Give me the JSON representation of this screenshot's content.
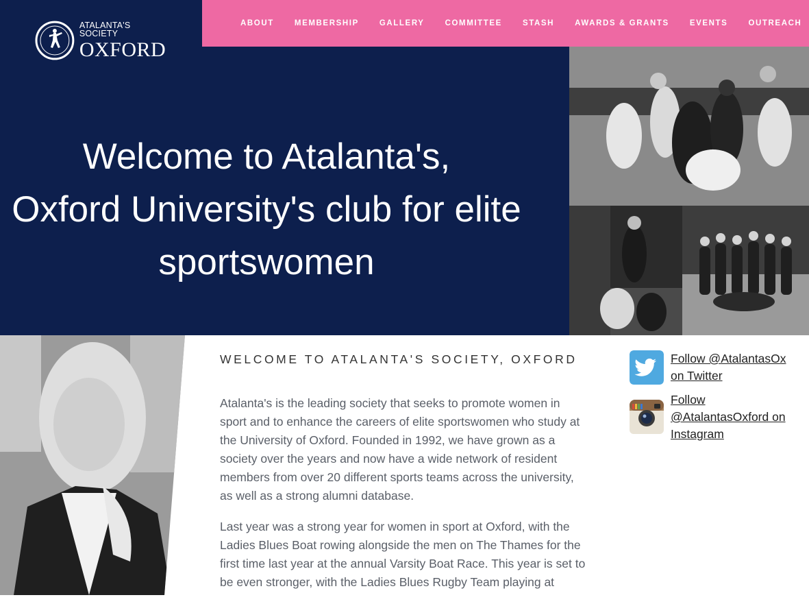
{
  "brand": {
    "logo_top": "ATALANTA'S SOCIETY",
    "logo_main": "OXFORD",
    "emblem_text": "Atalanta"
  },
  "nav": {
    "items": [
      "ABOUT",
      "MEMBERSHIP",
      "GALLERY",
      "COMMITTEE",
      "STASH",
      "AWARDS & GRANTS",
      "EVENTS",
      "OUTREACH"
    ]
  },
  "hero": {
    "title_lines": [
      "Welcome to Atalanta's,",
      "Oxford University's club for elite",
      "sportswomen"
    ]
  },
  "main": {
    "heading": "WELCOME TO ATALANTA'S SOCIETY, OXFORD",
    "paragraphs": [
      "Atalanta's is the leading society that seeks to promote women in sport and to enhance the careers of elite sportswomen who study at the University of Oxford. Founded in 1992, we have grown as a society over the years and now have a wide network of resident members from over 20 different sports teams across the university, as well as a strong alumni database.",
      "Last year was a strong year for women in sport at Oxford, with the Ladies Blues Boat rowing alongside the men on The Thames for the first time last year at the annual Varsity Boat Race. This year is set to be even stronger, with the Ladies Blues Rugby Team playing at"
    ]
  },
  "social": {
    "twitter": {
      "label": "Follow @AtalantasOx on Twitter",
      "icon": "twitter-icon"
    },
    "instagram": {
      "label": "Follow @AtalantasOxford on Instagram",
      "icon": "instagram-icon"
    }
  },
  "colors": {
    "navy": "#0d1f4d",
    "pink": "#ee69a3"
  }
}
